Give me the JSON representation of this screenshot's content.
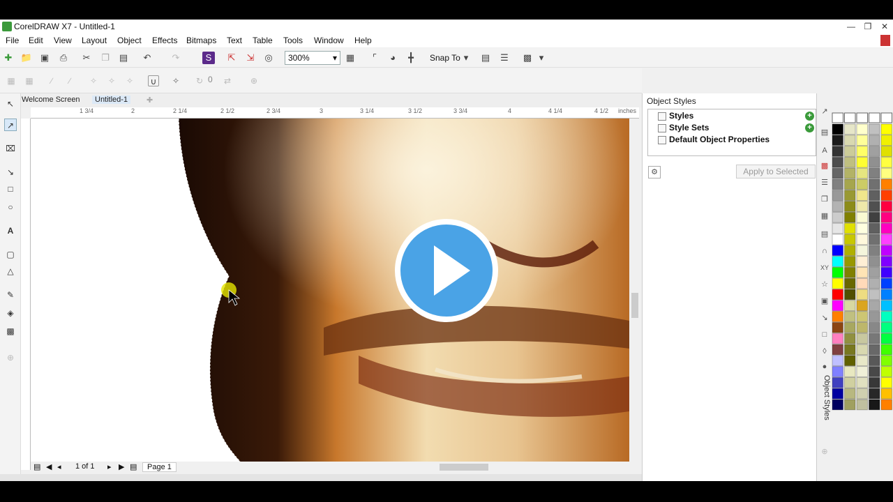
{
  "window": {
    "title": "CorelDRAW X7 - Untitled-1"
  },
  "menu": [
    "File",
    "Edit",
    "View",
    "Layout",
    "Object",
    "Effects",
    "Bitmaps",
    "Text",
    "Table",
    "Tools",
    "Window",
    "Help"
  ],
  "toolbar": {
    "zoom": "300%",
    "snap_label": "Snap To",
    "nudge_value": "0"
  },
  "tabs": {
    "welcome": "Welcome Screen",
    "document": "Untitled-1"
  },
  "ruler": {
    "h_ticks": [
      "1 3/4",
      "2",
      "2 1/4",
      "2 1/2",
      "2 3/4",
      "3",
      "3 1/4",
      "3 1/2",
      "3 3/4",
      "4",
      "4 1/4",
      "4 1/2",
      "inches"
    ]
  },
  "pager": {
    "count": "1 of 1",
    "page_tab": "Page 1"
  },
  "object_styles": {
    "title": "Object Styles",
    "tree": [
      "Styles",
      "Style Sets",
      "Default Object Properties"
    ],
    "apply_button": "Apply to Selected",
    "side_label": "Object Styles"
  },
  "palette_colors": {
    "col1": [
      "#000000",
      "#1a1a1a",
      "#333333",
      "#4d4d4d",
      "#666666",
      "#808080",
      "#999999",
      "#b3b3b3",
      "#cccccc",
      "#e6e6e6",
      "#ffffff",
      "#0000ff",
      "#00ffff",
      "#00ff00",
      "#ffff00",
      "#ff0000",
      "#ff00ff",
      "#ff8000",
      "#8b4513",
      "#ff80c0",
      "#804040",
      "#c0c0ff",
      "#8080ff",
      "#4040c0",
      "#0000a0",
      "#000060"
    ],
    "col2": [
      "#e6e6c8",
      "#d9d9b0",
      "#cccc99",
      "#bfbf80",
      "#b3b366",
      "#a6a64d",
      "#999933",
      "#8c8c1a",
      "#808000",
      "#e0e000",
      "#c8c800",
      "#b0b000",
      "#989800",
      "#808000",
      "#686800",
      "#505000",
      "#d8d8a0",
      "#c0c080",
      "#a8a860",
      "#909040",
      "#787820",
      "#606000",
      "#e8e8c0",
      "#d0d0a0",
      "#b8b880",
      "#a0a060"
    ],
    "col3": [
      "#ffffcc",
      "#ffff99",
      "#ffff66",
      "#ffff33",
      "#e6e680",
      "#cccc66",
      "#f0e68c",
      "#eee8aa",
      "#fafad2",
      "#ffffe0",
      "#fff8dc",
      "#f5f5dc",
      "#ffefd5",
      "#ffe4b5",
      "#ffdab9",
      "#eedd82",
      "#daa520",
      "#cdc673",
      "#bdb76b",
      "#c8c8a0",
      "#d8d8b0",
      "#e8e8c8",
      "#f0f0d8",
      "#e0e0c0",
      "#d0d0b0",
      "#c0c0a0"
    ],
    "col4": [
      "#c0c0c0",
      "#b0b0b0",
      "#a0a0a0",
      "#909090",
      "#808080",
      "#707070",
      "#606060",
      "#505050",
      "#404040",
      "#606060",
      "#707070",
      "#808080",
      "#909090",
      "#a0a0a0",
      "#b0b0b0",
      "#c0c0c0",
      "#a8a8a8",
      "#989898",
      "#888888",
      "#787878",
      "#686868",
      "#585858",
      "#484848",
      "#383838",
      "#282828",
      "#181818"
    ],
    "col5": [
      "#ffff00",
      "#f0f000",
      "#e0e000",
      "#ffff40",
      "#ffff80",
      "#ff8000",
      "#ff4000",
      "#ff0040",
      "#ff0080",
      "#ff00c0",
      "#ff40ff",
      "#c000ff",
      "#8000ff",
      "#4000ff",
      "#0040ff",
      "#0080ff",
      "#00c0ff",
      "#00ffc0",
      "#00ff80",
      "#00ff40",
      "#40ff00",
      "#80ff00",
      "#c0ff00",
      "#ffff00",
      "#ffc000",
      "#ff8000"
    ]
  }
}
